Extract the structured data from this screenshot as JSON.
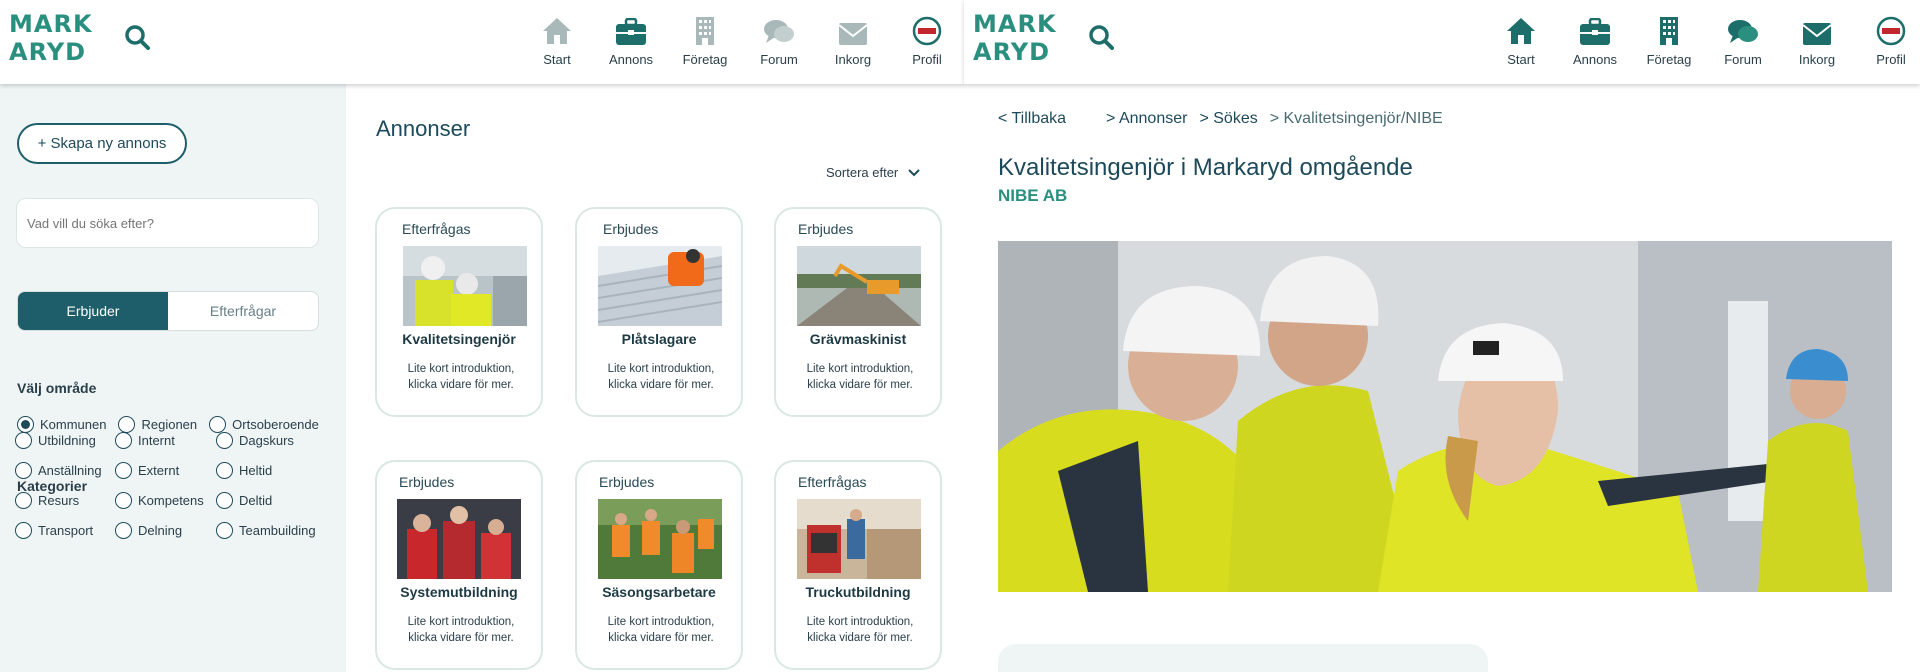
{
  "brand": {
    "logo_line1": "MARK",
    "logo_line2": "ARYD"
  },
  "nav": [
    {
      "label": "Start",
      "icon": "home-icon"
    },
    {
      "label": "Annons",
      "icon": "briefcase-icon"
    },
    {
      "label": "Företag",
      "icon": "building-icon"
    },
    {
      "label": "Forum",
      "icon": "chat-icon"
    },
    {
      "label": "Inkorg",
      "icon": "mail-icon"
    },
    {
      "label": "Profil",
      "icon": "avatar"
    }
  ],
  "profile_badge": "NIBE",
  "sidebar": {
    "create_label": "+ Skapa ny annons",
    "search_placeholder": "Vad vill du söka efter?",
    "toggle": {
      "on": "Erbjuder",
      "off": "Efterfrågar"
    },
    "area_title": "Välj område",
    "areas": [
      "Kommunen",
      "Regionen",
      "Ortsoberoende"
    ],
    "categories_title": "Kategorier",
    "categories": [
      "Utbildning",
      "Internt",
      "Dagskurs",
      "Anställning",
      "Externt",
      "Heltid",
      "Resurs",
      "Kompetens",
      "Deltid",
      "Transport",
      "Delning",
      "Teambuilding"
    ]
  },
  "listing": {
    "title": "Annonser",
    "sort_label": "Sortera efter",
    "cards": [
      {
        "kind": "Efterfrågas",
        "title": "Kvalitetsingenjör",
        "desc": "Lite kort introduktion, klicka vidare för mer."
      },
      {
        "kind": "Erbjudes",
        "title": "Plåtslagare",
        "desc": "Lite kort introduktion, klicka vidare för mer."
      },
      {
        "kind": "Erbjudes",
        "title": "Grävmaskinist",
        "desc": "Lite kort introduktion, klicka vidare för mer."
      },
      {
        "kind": "Erbjudes",
        "title": "Systemutbildning",
        "desc": "Lite kort introduktion, klicka vidare för mer."
      },
      {
        "kind": "Erbjudes",
        "title": "Säsongsarbetare",
        "desc": "Lite kort introduktion, klicka vidare för mer."
      },
      {
        "kind": "Efterfrågas",
        "title": "Truckutbildning",
        "desc": "Lite kort introduktion, klicka vidare för mer."
      }
    ]
  },
  "detail": {
    "back": "< Tillbaka",
    "crumbs": [
      "> Annonser",
      "> Sökes",
      "> Kvalitetsingenjör/NIBE"
    ],
    "title": "Kvalitetsingenjör i Markaryd omgående",
    "company": "NIBE AB"
  },
  "colors": {
    "accent": "#2a8f7e",
    "primary": "#1d5e6a",
    "sidebar_bg": "#eff5f5"
  }
}
